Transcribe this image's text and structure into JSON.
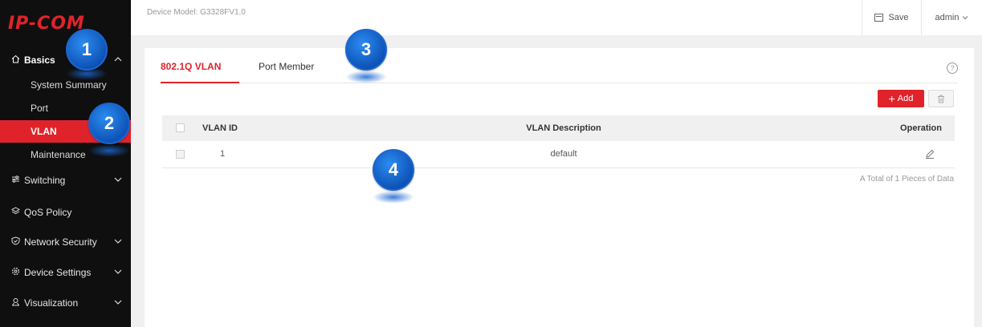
{
  "brand": {
    "logo_text": "IP-COM",
    "accent": "#e0232b"
  },
  "topbar": {
    "device_model": "Device Model: G3328FV1.0",
    "save_label": "Save",
    "user_label": "admin"
  },
  "sidebar": {
    "groups": [
      {
        "label": "Basics",
        "icon": "home-icon",
        "expanded": true
      },
      {
        "label": "Switching",
        "icon": "sliders-icon"
      },
      {
        "label": "QoS Policy",
        "icon": "layers-icon"
      },
      {
        "label": "Network Security",
        "icon": "shield-icon"
      },
      {
        "label": "Device Settings",
        "icon": "gear-icon"
      },
      {
        "label": "Visualization",
        "icon": "chart-icon"
      }
    ],
    "basics_items": [
      {
        "label": "System Summary"
      },
      {
        "label": "Port"
      },
      {
        "label": "VLAN",
        "active": true
      },
      {
        "label": "Maintenance"
      }
    ]
  },
  "tabs": [
    {
      "label": "802.1Q VLAN",
      "active": true
    },
    {
      "label": "Port Member"
    }
  ],
  "toolbar": {
    "add_label": "Add"
  },
  "table": {
    "headers": [
      "VLAN ID",
      "VLAN Description",
      "Operation"
    ],
    "rows": [
      {
        "vlan_id": "1",
        "description": "default"
      }
    ],
    "total_text": "A Total of 1 Pieces of Data"
  },
  "callouts": [
    "1",
    "2",
    "3",
    "4"
  ]
}
